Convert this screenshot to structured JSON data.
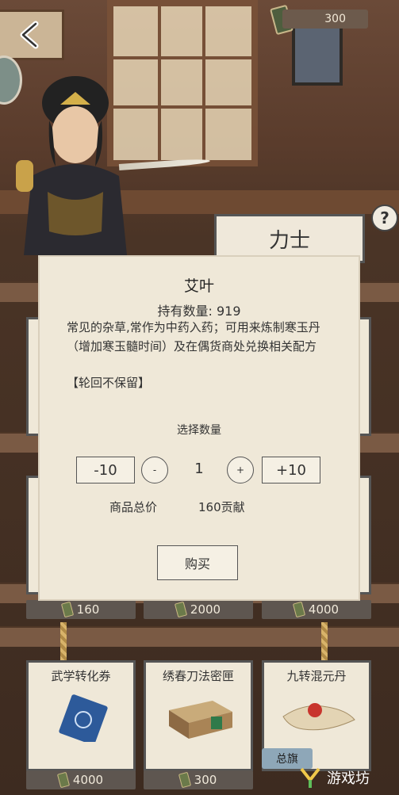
{
  "header": {
    "currency_value": "300"
  },
  "shop": {
    "category_title": "力士",
    "row1_prices": [
      "160",
      "2000",
      "4000"
    ],
    "row2_items": [
      {
        "name": "武学转化券",
        "price": "4000"
      },
      {
        "name": "绣春刀法密匣",
        "price": "300"
      },
      {
        "name": "九转混元丹",
        "price": ""
      }
    ]
  },
  "dialog": {
    "item_name": "艾叶",
    "owned": "持有数量: 919",
    "description": "常见的杂草,常作为中药入药；可用来炼制寒玉丹（增加寒玉髓时间）及在偶货商处兑换相关配方",
    "tag": "【轮回不保留】",
    "qty_label": "选择数量",
    "minus10": "-10",
    "minus": "-",
    "qty": "1",
    "plus": "+",
    "plus10": "+10",
    "total_label": "商品总价",
    "total_value": "160贡献",
    "buy": "购买"
  },
  "bottom": {
    "tab_label": "总旗",
    "watermark": "游戏坊"
  }
}
